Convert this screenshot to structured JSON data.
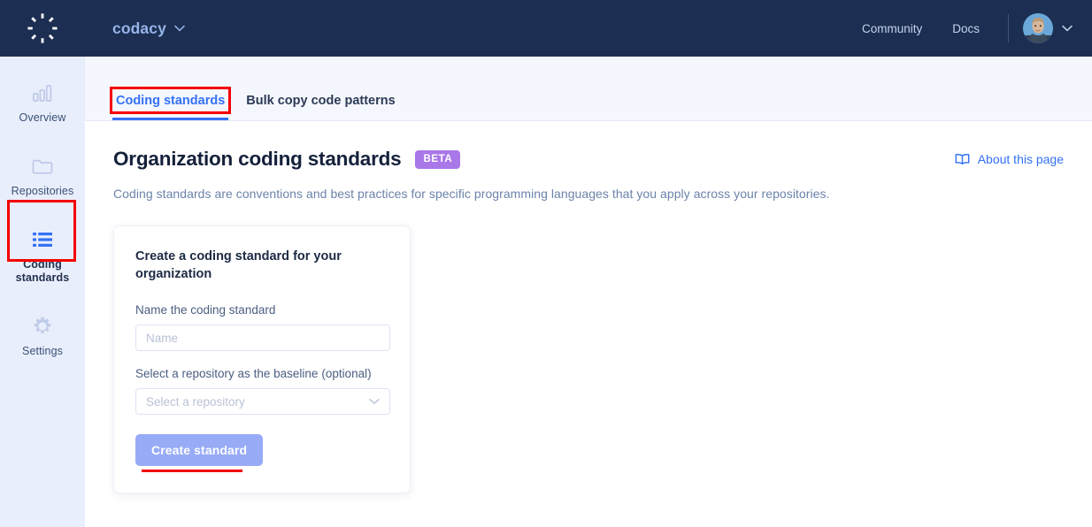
{
  "header": {
    "logo_icon": "codacy-logo-icon",
    "org_name": "codacy",
    "org_chevron_icon": "chevron-down-icon",
    "links": [
      {
        "label": "Community",
        "name": "community-link"
      },
      {
        "label": "Docs",
        "name": "docs-link"
      }
    ],
    "avatar_icon": "user-avatar",
    "avatar_chevron_icon": "chevron-down-icon"
  },
  "sidebar": {
    "items": [
      {
        "label": "Overview",
        "icon": "bar-chart-icon",
        "active": false
      },
      {
        "label": "Repositories",
        "icon": "folder-icon",
        "active": false
      },
      {
        "label": "Coding standards",
        "icon": "list-icon",
        "active": true
      },
      {
        "label": "Settings",
        "icon": "gear-icon",
        "active": false
      }
    ]
  },
  "tabs": [
    {
      "label": "Coding standards",
      "active": true
    },
    {
      "label": "Bulk copy code patterns",
      "active": false
    }
  ],
  "page": {
    "title": "Organization coding standards",
    "badge": "BETA",
    "description": "Coding standards are conventions and best practices for specific programming languages that you apply across your repositories.",
    "about_link": "About this page",
    "about_icon": "book-icon"
  },
  "card": {
    "title": "Create a coding standard for your organization",
    "name_label": "Name the coding standard",
    "name_placeholder": "Name",
    "name_value": "",
    "repo_label": "Select a repository as the baseline",
    "repo_optional": "(optional)",
    "repo_placeholder": "Select a repository",
    "repo_caret_icon": "chevron-down-icon",
    "submit_label": "Create standard"
  },
  "colors": {
    "header_bg": "#1c2f52",
    "sidebar_bg": "#e9eefc",
    "tabbar_bg": "#f5f7fe",
    "accent_blue": "#3471f5",
    "beta_purple": "#a978e8",
    "button_disabled": "#97abf6",
    "annotation_red": "#f40000"
  },
  "annotations": [
    {
      "name": "annotation-tab-coding-standards",
      "shape": "box"
    },
    {
      "name": "annotation-sidebar-coding-standards",
      "shape": "box"
    },
    {
      "name": "annotation-create-standard-button",
      "shape": "underline"
    }
  ]
}
